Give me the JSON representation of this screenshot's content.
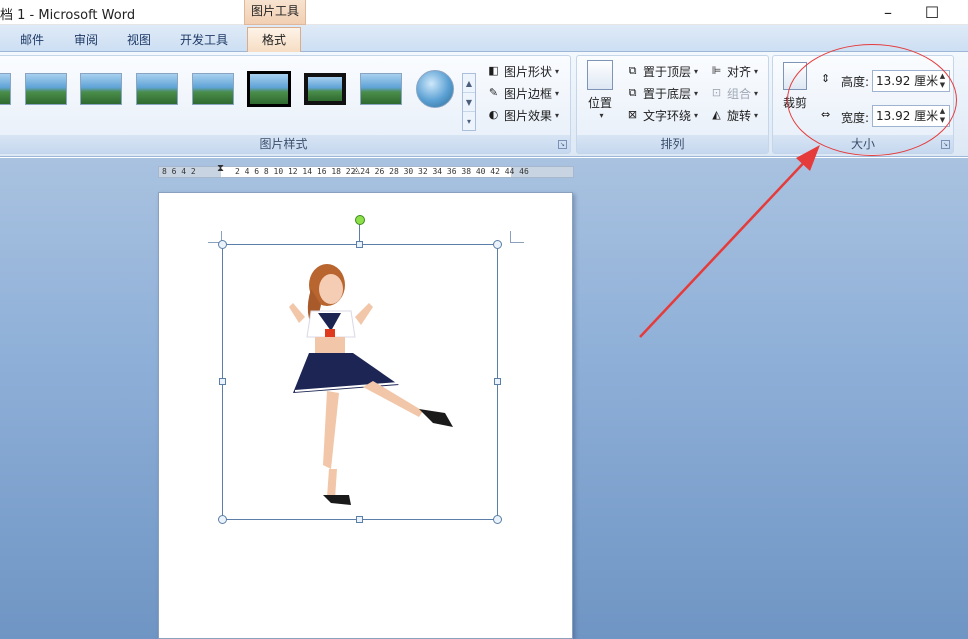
{
  "window": {
    "title": "档 1 - Microsoft Word",
    "context_tab_header": "图片工具",
    "minimize_glyph": "–",
    "maximize_glyph": "☐"
  },
  "tabs": [
    {
      "label": "邮件"
    },
    {
      "label": "审阅"
    },
    {
      "label": "视图"
    },
    {
      "label": "开发工具"
    },
    {
      "label": "格式",
      "active": true
    }
  ],
  "picture_styles": {
    "group_label": "图片样式",
    "commands": {
      "shape": "图片形状",
      "border": "图片边框",
      "effects": "图片效果"
    }
  },
  "arrange": {
    "group_label": "排列",
    "position": "位置",
    "bring_to_front": "置于顶层",
    "send_to_back": "置于底层",
    "text_wrapping": "文字环绕",
    "align": "对齐",
    "group": "组合",
    "rotate": "旋转"
  },
  "size": {
    "group_label": "大小",
    "crop": "裁剪",
    "height_label": "高度:",
    "height_value": "13.92 厘米",
    "width_label": "宽度:",
    "width_value": "13.92 厘米"
  },
  "ruler": {
    "left_numbers": "8  6  4  2",
    "right_numbers": "2  4  6  8  10 12 14 16 18    22 24 26 28 30 32 34 36 38 40 42 44 46"
  },
  "colors": {
    "annotation": "#e53b3b",
    "context_tab": "#f1cfb3",
    "workspace": "#8fb0d8"
  }
}
